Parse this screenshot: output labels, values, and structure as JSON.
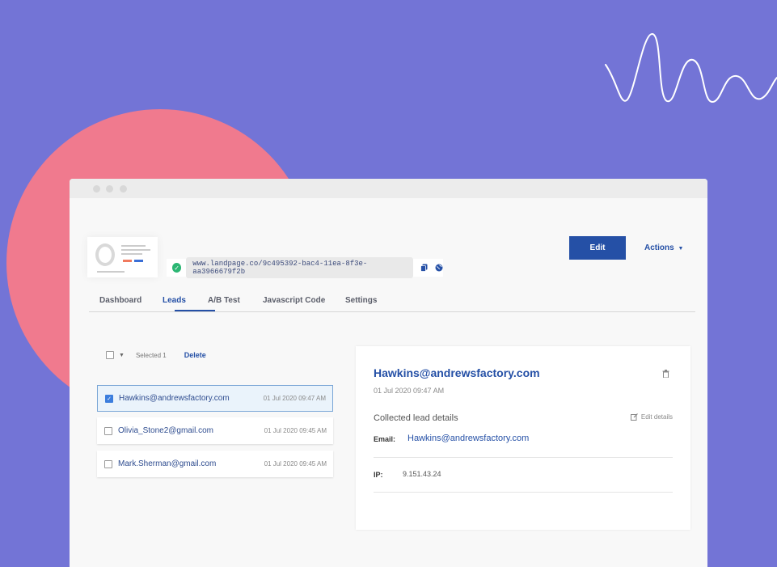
{
  "url": "www.landpage.co/9c495392-bac4-11ea-8f3e-aa3966679f2b",
  "header": {
    "edit_label": "Edit",
    "actions_label": "Actions"
  },
  "tabs": [
    {
      "label": "Dashboard"
    },
    {
      "label": "Leads",
      "active": true
    },
    {
      "label": "A/B Test"
    },
    {
      "label": "Javascript Code"
    },
    {
      "label": "Settings"
    }
  ],
  "toolbar": {
    "selected_text": "Selected 1",
    "delete_label": "Delete"
  },
  "leads": [
    {
      "email": "Hawkins@andrewsfactory.com",
      "date": "01 Jul 2020 09:47 AM",
      "checked": true
    },
    {
      "email": "Olivia_Stone2@gmail.com",
      "date": "01 Jul 2020 09:45 AM",
      "checked": false
    },
    {
      "email": "Mark.Sherman@gmail.com",
      "date": "01 Jul 2020 09:45 AM",
      "checked": false
    }
  ],
  "detail": {
    "title": "Hawkins@andrewsfactory.com",
    "time": "01 Jul 2020 09:47 AM",
    "collected_label": "Collected lead details",
    "edit_details_label": "Edit details",
    "email_label": "Email:",
    "email_value": "Hawkins@andrewsfactory.com",
    "ip_label": "IP:",
    "ip_value": "9.151.43.24"
  },
  "colors": {
    "background": "#7374d6",
    "blob": "#f07a8e",
    "accent": "#2550a6",
    "success": "#2bb673"
  }
}
